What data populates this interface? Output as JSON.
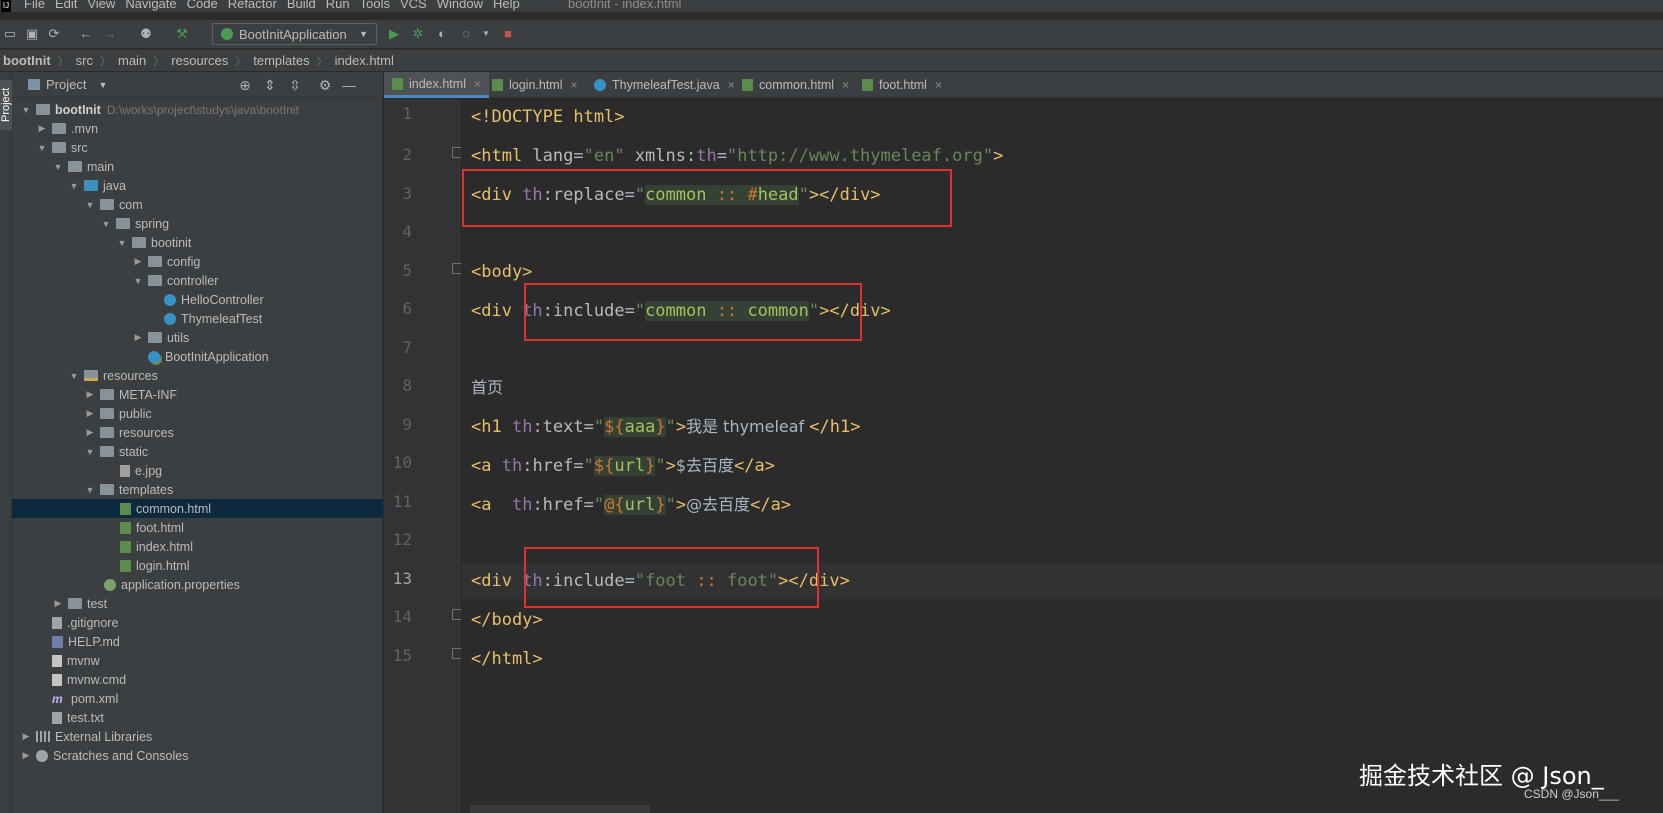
{
  "window_title": "bootInit - index.html",
  "app_icon_label": "IJ",
  "menu": [
    "File",
    "Edit",
    "View",
    "Navigate",
    "Code",
    "Refactor",
    "Build",
    "Run",
    "Tools",
    "VCS",
    "Window",
    "Help"
  ],
  "toolbar": {
    "run_configuration": "BootInitApplication"
  },
  "breadcrumb": [
    "bootInit",
    "src",
    "main",
    "resources",
    "templates",
    "index.html"
  ],
  "project_panel": {
    "stripe_label": "Project",
    "title": "Project",
    "tree": [
      {
        "label": "bootInit",
        "path": "D:\\works\\project\\studys\\java\\bootInit"
      },
      {
        "label": ".mvn"
      },
      {
        "label": "src"
      },
      {
        "label": "main"
      },
      {
        "label": "java"
      },
      {
        "label": "com"
      },
      {
        "label": "spring"
      },
      {
        "label": "bootinit"
      },
      {
        "label": "config"
      },
      {
        "label": "controller"
      },
      {
        "label": "HelloController"
      },
      {
        "label": "ThymeleafTest"
      },
      {
        "label": "utils"
      },
      {
        "label": "BootInitApplication"
      },
      {
        "label": "resources"
      },
      {
        "label": "META-INF"
      },
      {
        "label": "public"
      },
      {
        "label": "resources"
      },
      {
        "label": "static"
      },
      {
        "label": "e.jpg"
      },
      {
        "label": "templates"
      },
      {
        "label": "common.html"
      },
      {
        "label": "foot.html"
      },
      {
        "label": "index.html"
      },
      {
        "label": "login.html"
      },
      {
        "label": "application.properties"
      },
      {
        "label": "test"
      },
      {
        "label": ".gitignore"
      },
      {
        "label": "HELP.md"
      },
      {
        "label": "mvnw"
      },
      {
        "label": "mvnw.cmd"
      },
      {
        "label": "pom.xml"
      },
      {
        "label": "test.txt"
      },
      {
        "label": "External Libraries"
      },
      {
        "label": "Scratches and Consoles"
      }
    ]
  },
  "editor": {
    "tabs": [
      "index.html",
      "login.html",
      "ThymeleafTest.java",
      "common.html",
      "foot.html"
    ],
    "active_tab": "index.html",
    "line_numbers": [
      "1",
      "2",
      "3",
      "4",
      "5",
      "6",
      "7",
      "8",
      "9",
      "10",
      "11",
      "12",
      "13",
      "14",
      "15"
    ],
    "current_line": "13",
    "code": {
      "l1": "<!DOCTYPE html>",
      "l2_open": "<html ",
      "l2_a1": "lang",
      "l2_eq1": "=",
      "l2_v1": "\"en\"",
      "l2_a2": " xmlns:",
      "l2_ns": "th",
      "l2_eq2": "=",
      "l2_v2": "\"http://www.thymeleaf.org\"",
      "l2_close": ">",
      "l3_open": "<div ",
      "l3_ns": "th",
      "l3_attr": ":replace",
      "l3_eq": "=",
      "l3_q1": "\"",
      "l3_v1": "common ",
      "l3_op": "::",
      "l3_v2": " #",
      "l3_v3": "head",
      "l3_q2": "\"",
      "l3_close": "></div>",
      "l5": "<body>",
      "l6_open": "<div ",
      "l6_ns": "th",
      "l6_attr": ":include",
      "l6_eq": "=",
      "l6_q1": "\"",
      "l6_v1": "common ",
      "l6_op": "::",
      "l6_v2": " common",
      "l6_q2": "\"",
      "l6_close": "></div>",
      "l8": "首页",
      "l9_open": "<h1 ",
      "l9_ns": "th",
      "l9_attr": ":text",
      "l9_eq": "=",
      "l9_q1": "\"",
      "l9_ex1": "${",
      "l9_var": "aaa",
      "l9_ex2": "}",
      "l9_q2": "\"",
      "l9_gt": ">",
      "l9_text": "我是 thymeleaf ",
      "l9_close": "</h1>",
      "l10_open": "<a ",
      "l10_ns": "th",
      "l10_attr": ":href",
      "l10_eq": "=",
      "l10_q1": "\"",
      "l10_ex1": "${",
      "l10_var": "url",
      "l10_ex2": "}",
      "l10_q2": "\"",
      "l10_gt": ">",
      "l10_text": "$去百度",
      "l10_close": "</a>",
      "l11_open": "<a  ",
      "l11_ns": "th",
      "l11_attr": ":href",
      "l11_eq": "=",
      "l11_q1": "\"",
      "l11_ex1": "@{",
      "l11_var": "url",
      "l11_ex2": "}",
      "l11_q2": "\"",
      "l11_gt": ">",
      "l11_text": "@去百度",
      "l11_close": "</a>",
      "l13_open": "<div ",
      "l13_ns": "th",
      "l13_attr": ":include",
      "l13_eq": "=",
      "l13_q1": "\"",
      "l13_v1": "foot ",
      "l13_op": "::",
      "l13_v2": " foot",
      "l13_q2": "\"",
      "l13_close": "></div>",
      "l14": "</body>",
      "l15": "</html>"
    }
  },
  "watermark": {
    "main": "掘金技术社区 @ Json_",
    "sub": "CSDN @Json___"
  },
  "colors": {
    "tag": "#e8bf6a",
    "attr_value": "#6a8759",
    "namespace": "#9876aa",
    "highlight_box": "#e03131",
    "selection": "#0d293e"
  }
}
